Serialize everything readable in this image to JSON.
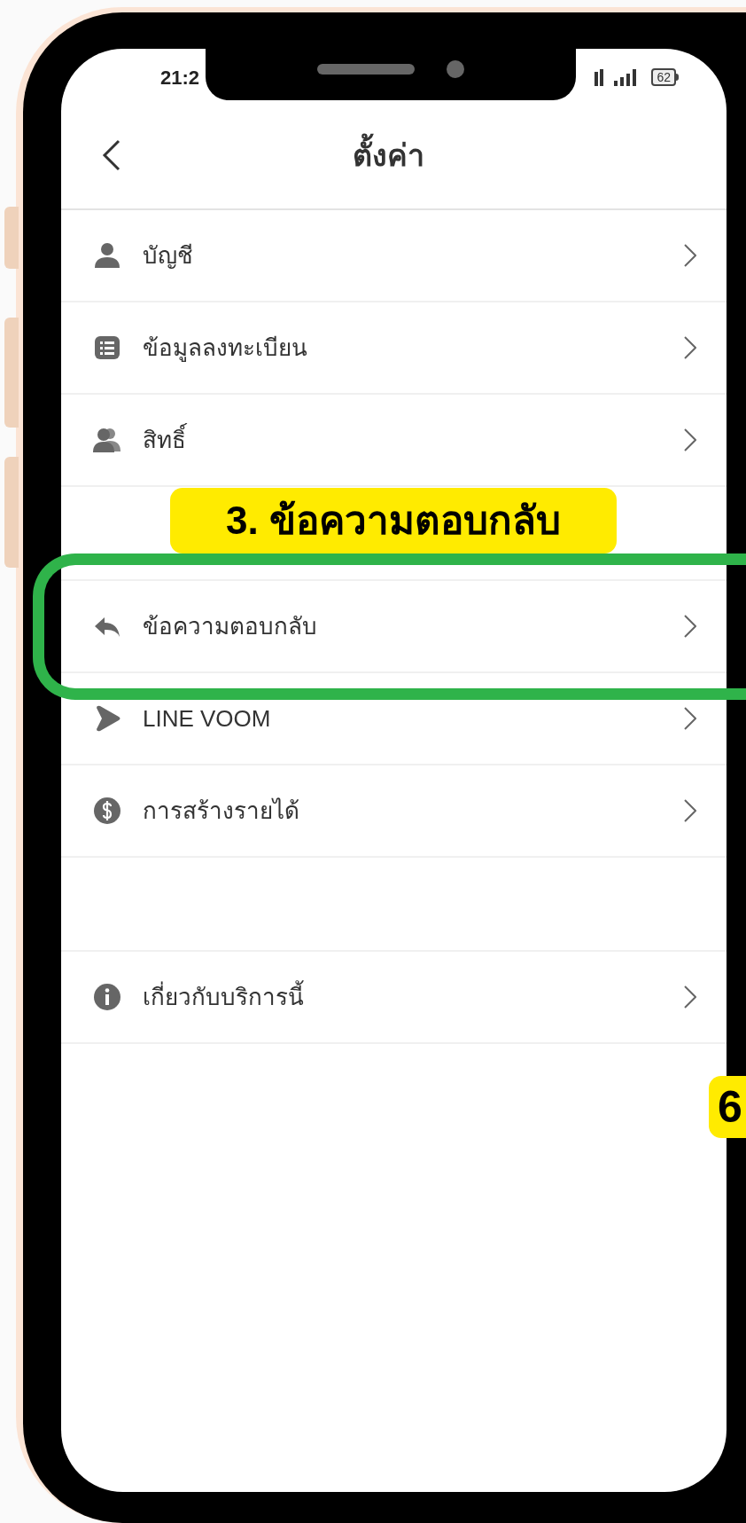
{
  "status_bar": {
    "time": "21:2",
    "battery": "62"
  },
  "header": {
    "title": "ตั้งค่า"
  },
  "sections": [
    {
      "items": [
        {
          "kind": "person",
          "label": "บัญชี"
        },
        {
          "kind": "list",
          "label": "ข้อมูลลงทะเบียน"
        },
        {
          "kind": "people",
          "label": "สิทธิ์"
        }
      ]
    },
    {
      "items": [
        {
          "kind": "reply",
          "label": "ข้อความตอบกลับ"
        },
        {
          "kind": "play",
          "label": "LINE VOOM"
        },
        {
          "kind": "coin",
          "label": "การสร้างรายได้"
        }
      ]
    },
    {
      "items": [
        {
          "kind": "info",
          "label": "เกี่ยวกับบริการนี้"
        }
      ]
    }
  ],
  "annotations": {
    "step_label": "3. ข้อความตอบกลับ",
    "side_badge": "6"
  }
}
